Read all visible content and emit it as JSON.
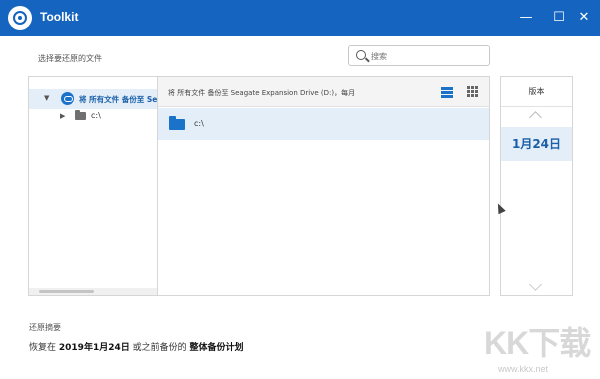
{
  "window": {
    "title": "Toolkit",
    "minimize_glyph": "—",
    "maximize_glyph": "☐",
    "close_glyph": "✕",
    "accent": "#1565c0"
  },
  "restore": {
    "select_label": "选择要还原的文件",
    "search_placeholder": "搜索"
  },
  "tree": {
    "items": [
      {
        "caret": "▼",
        "label": "将 所有文件 备份至 Seagate",
        "icon": "cloud-backup-icon"
      },
      {
        "caret": "▶",
        "label": "c:\\",
        "icon": "folder-icon"
      }
    ]
  },
  "files": {
    "header": "将 所有文件 备份至 Seagate Expansion Drive (D:)，每月",
    "rows": [
      {
        "name": "c:\\",
        "icon": "folder-icon"
      }
    ]
  },
  "versions": {
    "header": "版本",
    "selected": "1月24日"
  },
  "summary": {
    "title": "还原摘要",
    "prefix": "恢复在",
    "date": "2019年1月24日",
    "middle": "或之前备份的",
    "plan": "整体备份计划"
  },
  "watermark": {
    "big": "KK下载",
    "small": "www.kkx.net"
  },
  "colors": {
    "selection": "#e3eef8",
    "folder": "#1a73c9"
  }
}
